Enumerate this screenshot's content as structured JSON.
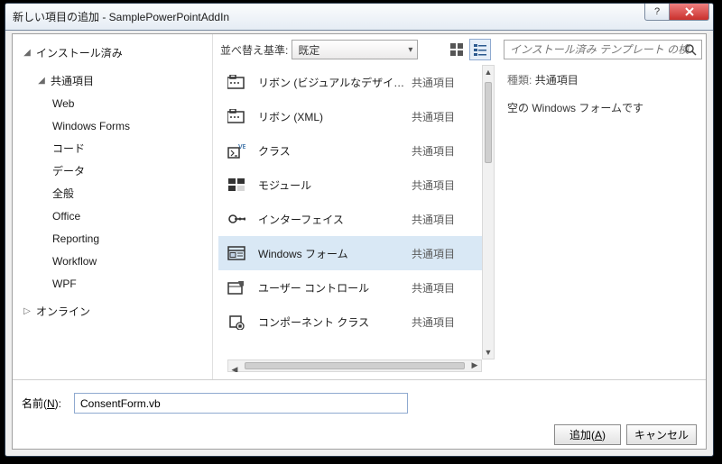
{
  "window": {
    "title": "新しい項目の追加 - SamplePowerPointAddIn"
  },
  "tree": {
    "installed": "インストール済み",
    "common": "共通項目",
    "children": [
      "Web",
      "Windows Forms",
      "コード",
      "データ",
      "全般",
      "Office",
      "Reporting",
      "Workflow",
      "WPF"
    ],
    "online": "オンライン"
  },
  "toolbar": {
    "sort_label": "並べ替え基準:",
    "sort_value": "既定"
  },
  "items": [
    {
      "name": "リボン (ビジュアルなデザイ…",
      "cat": "共通項目"
    },
    {
      "name": "リボン (XML)",
      "cat": "共通項目"
    },
    {
      "name": "クラス",
      "cat": "共通項目"
    },
    {
      "name": "モジュール",
      "cat": "共通項目"
    },
    {
      "name": "インターフェイス",
      "cat": "共通項目"
    },
    {
      "name": "Windows フォーム",
      "cat": "共通項目"
    },
    {
      "name": "ユーザー コントロール",
      "cat": "共通項目"
    },
    {
      "name": "コンポーネント クラス",
      "cat": "共通項目"
    }
  ],
  "selected_index": 5,
  "search": {
    "placeholder": "インストール済み テンプレート の検"
  },
  "detail": {
    "type_label": "種類:",
    "type_value": "共通項目",
    "desc": "空の Windows フォームです"
  },
  "name_field": {
    "label_pre": "名前(",
    "label_key": "N",
    "label_post": "):",
    "value": "ConsentForm.vb"
  },
  "buttons": {
    "add_pre": "追加(",
    "add_key": "A",
    "add_post": ")",
    "cancel": "キャンセル"
  }
}
